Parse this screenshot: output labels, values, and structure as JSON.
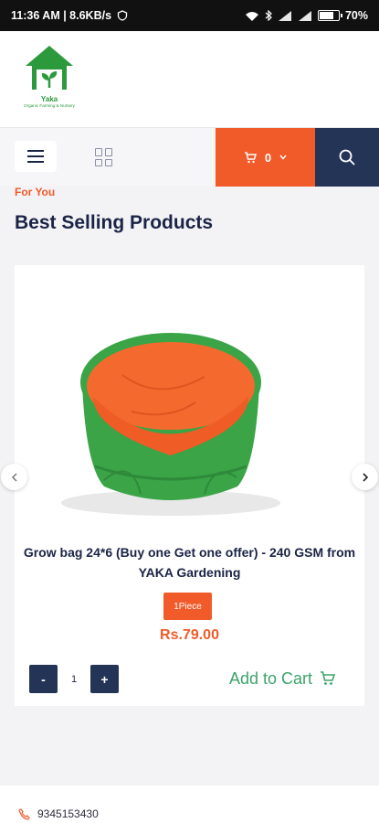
{
  "status_bar": {
    "time_speed": "11:36 AM | 8.6KB/s",
    "battery": "70%",
    "battery_level": 0.7
  },
  "header": {
    "logo": {
      "brand": "Yaka",
      "tagline": "Organic Farming & Nursery"
    }
  },
  "nav": {
    "cart_count": "0",
    "icons": [
      "menu-icon",
      "grid-icon",
      "cart-icon",
      "chevron-down-icon",
      "search-icon"
    ],
    "colors": {
      "cart_bg": "#f15a29",
      "search_bg": "#243457"
    }
  },
  "section": {
    "eyebrow": "For You",
    "title": "Best Selling Products"
  },
  "product": {
    "name": "Grow bag 24*6 (Buy one Get one offer) - 240 GSM from YAKA Gardening",
    "unit_badge": "1Piece",
    "price": "Rs.79.00",
    "quantity": "1",
    "minus_label": "-",
    "plus_label": "+",
    "add_to_cart": "Add to Cart"
  },
  "footer": {
    "phone": "9345153430"
  }
}
